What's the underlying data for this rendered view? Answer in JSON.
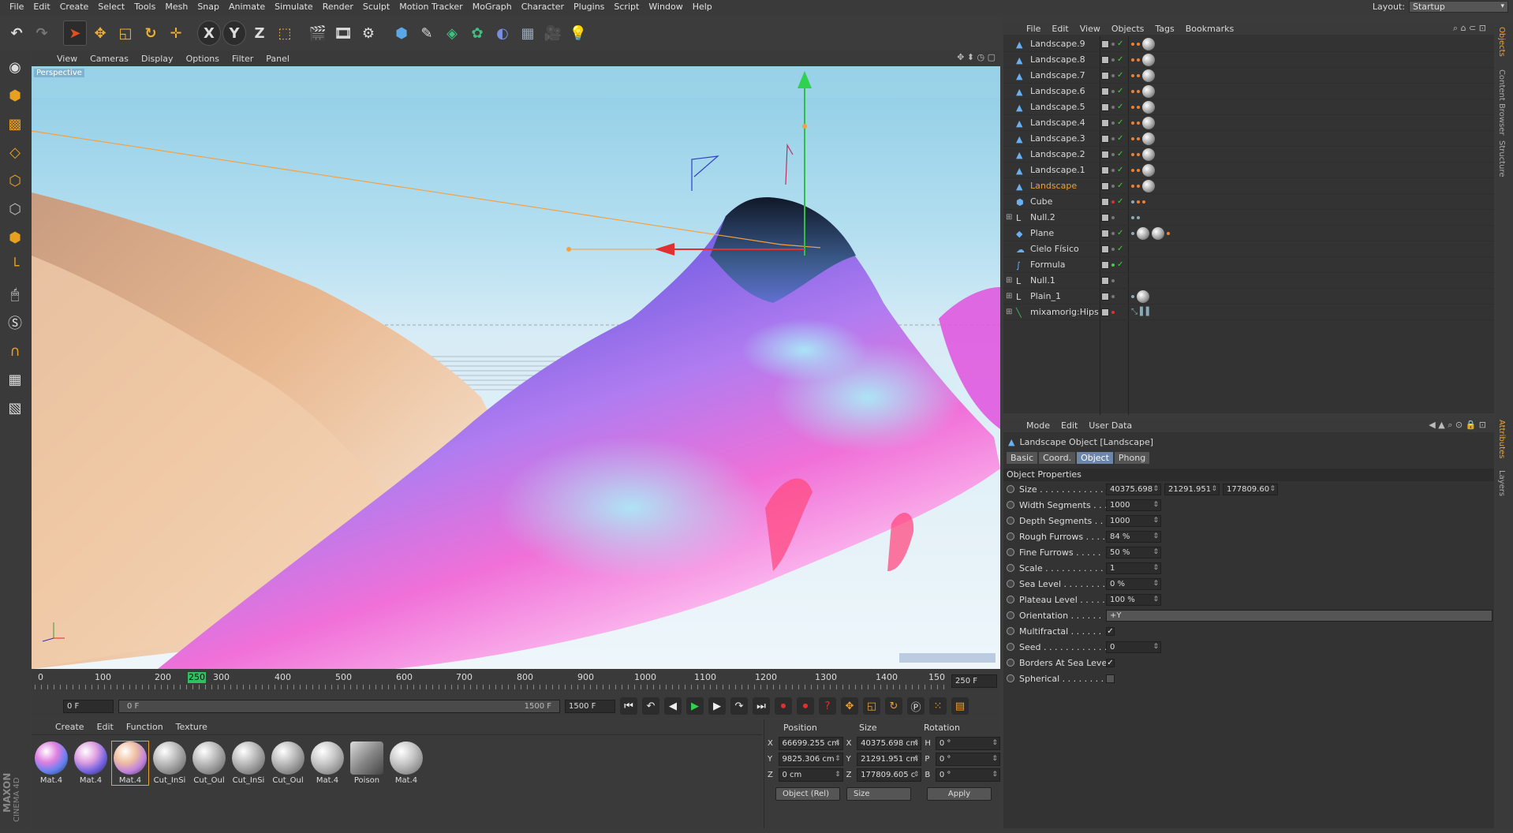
{
  "menu": [
    "File",
    "Edit",
    "Create",
    "Select",
    "Tools",
    "Mesh",
    "Snap",
    "Animate",
    "Simulate",
    "Render",
    "Sculpt",
    "Motion Tracker",
    "MoGraph",
    "Character",
    "Plugins",
    "Script",
    "Window",
    "Help"
  ],
  "layout": {
    "label": "Layout:",
    "value": "Startup"
  },
  "toolbar": {
    "x_label": "X",
    "y_label": "Y",
    "z_label": "Z"
  },
  "viewport_menu": [
    "View",
    "Cameras",
    "Display",
    "Options",
    "Filter",
    "Panel"
  ],
  "viewport": {
    "camera_label": "Perspective"
  },
  "timeline": {
    "ticks": [
      "0",
      "100",
      "200",
      "250",
      "300",
      "400",
      "500",
      "600",
      "700",
      "800",
      "900",
      "1000",
      "1100",
      "1200",
      "1300",
      "1400",
      "150"
    ],
    "end_field": "250 F",
    "current_marker": "250"
  },
  "playback": {
    "start_field": "0 F",
    "slider_left": "0 F",
    "slider_right": "1500 F",
    "end_field": "1500 F"
  },
  "material_menu": [
    "Create",
    "Edit",
    "Function",
    "Texture"
  ],
  "materials": [
    "Mat.4",
    "Mat.4",
    "Mat.4",
    "Cut_InSi",
    "Cut_Oul",
    "Cut_InSi",
    "Cut_Oul",
    "Mat.4",
    "Poison",
    "Mat.4"
  ],
  "branding": {
    "maxon": "MAXON",
    "product": "CINEMA 4D"
  },
  "coordinates": {
    "headers": {
      "position": "Position",
      "size": "Size",
      "rotation": "Rotation"
    },
    "rows": [
      {
        "axis": "X",
        "pos": "66699.255 cm",
        "size_axis": "X",
        "size": "40375.698 cm",
        "rot_axis": "H",
        "rot": "0 °"
      },
      {
        "axis": "Y",
        "pos": "9825.306 cm",
        "size_axis": "Y",
        "size": "21291.951 cm",
        "rot_axis": "P",
        "rot": "0 °"
      },
      {
        "axis": "Z",
        "pos": "0 cm",
        "size_axis": "Z",
        "size": "177809.605 c",
        "rot_axis": "B",
        "rot": "0 °"
      }
    ],
    "mode_select": "Object (Rel)",
    "size_select": "Size",
    "apply": "Apply"
  },
  "object_menu": [
    "File",
    "Edit",
    "View",
    "Objects",
    "Tags",
    "Bookmarks"
  ],
  "objects": [
    {
      "name": "Landscape.9",
      "highlight": false
    },
    {
      "name": "Landscape.8",
      "highlight": false
    },
    {
      "name": "Landscape.7",
      "highlight": false
    },
    {
      "name": "Landscape.6",
      "highlight": false
    },
    {
      "name": "Landscape.5",
      "highlight": false
    },
    {
      "name": "Landscape.4",
      "highlight": false
    },
    {
      "name": "Landscape.3",
      "highlight": false
    },
    {
      "name": "Landscape.2",
      "highlight": false
    },
    {
      "name": "Landscape.1",
      "highlight": false
    },
    {
      "name": "Landscape",
      "highlight": true
    },
    {
      "name": "Cube",
      "highlight": false
    },
    {
      "name": "Null.2",
      "highlight": false
    },
    {
      "name": "Plane",
      "highlight": false
    },
    {
      "name": "Cielo Físico",
      "highlight": false
    },
    {
      "name": "Formula",
      "highlight": false
    },
    {
      "name": "Null.1",
      "highlight": false
    },
    {
      "name": "Plain_1",
      "highlight": false
    },
    {
      "name": "mixamorig:Hips",
      "highlight": false
    }
  ],
  "attributes": {
    "menu": [
      "Mode",
      "Edit",
      "User Data"
    ],
    "title": "Landscape Object [Landscape]",
    "tabs": [
      "Basic",
      "Coord.",
      "Object",
      "Phong"
    ],
    "active_tab": "Object",
    "section": "Object Properties",
    "size": {
      "label": "Size . . . . . . . . . . . . .",
      "x": "40375.698",
      "y": "21291.951",
      "z": "177809.60"
    },
    "props": [
      {
        "label": "Width Segments . . .",
        "value": "1000"
      },
      {
        "label": "Depth Segments . . .",
        "value": "1000"
      },
      {
        "label": "Rough Furrows . . . .",
        "value": "84 %"
      },
      {
        "label": "Fine Furrows . . . . .",
        "value": "50 %"
      },
      {
        "label": "Scale . . . . . . . . . . .",
        "value": "1"
      },
      {
        "label": "Sea Level . . . . . . . .",
        "value": "0 %"
      },
      {
        "label": "Plateau Level . . . . .",
        "value": "100 %"
      }
    ],
    "orientation": {
      "label": "Orientation . . . . . .",
      "value": "+Y"
    },
    "multifractal": {
      "label": "Multifractal . . . . . .",
      "checked": true
    },
    "seed": {
      "label": "Seed . . . . . . . . . . . .",
      "value": "0"
    },
    "borders": {
      "label": "Borders At Sea Level",
      "checked": true
    },
    "spherical": {
      "label": "Spherical . . . . . . . .",
      "checked": false
    }
  },
  "side_tabs": [
    "Objects",
    "Content Browser",
    "Structure",
    "Attributes",
    "Layers"
  ],
  "colors": {
    "accent": "#f0a030",
    "highlight_text": "#f0a030",
    "active_tab": "#6b86a8"
  }
}
